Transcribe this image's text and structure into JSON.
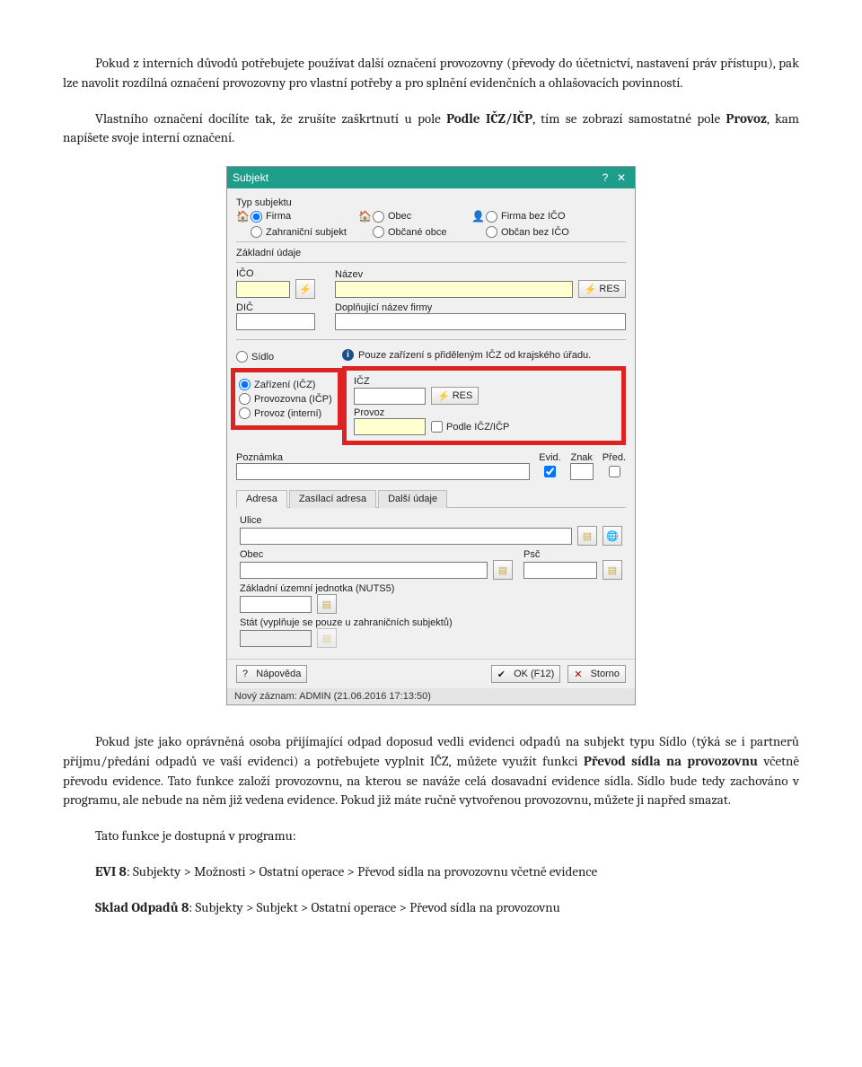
{
  "para1_prefix": "Pokud z",
  "para1_mid": "interních důvodů potřebujete používat další označení provozovny (převody do účetnictví, nastavení práv přístupu), pak lze navolit rozdílná označení provozovny pro vlastní potřeby a pro splnění evidenčních a ohlašovacích povinností.",
  "para2_prefix": "Vlastního označení docílíte tak, že zrušíte zaškrtnutí u pole ",
  "para2_bold1": "Podle IČZ/IČP",
  "para2_mid": ", tím se zobrazí samostatné pole ",
  "para2_bold2": "Provoz",
  "para2_suffix": ", kam napíšete svoje interní označení.",
  "dialog": {
    "title": "Subjekt",
    "typ_label": "Typ subjektu",
    "typ": {
      "firma": "Firma",
      "zahranicni": "Zahraniční subjekt",
      "obec": "Obec",
      "obcane": "Občané obce",
      "firma_bez": "Firma bez IČO",
      "obcan_bez": "Občan bez IČO"
    },
    "zakladni": "Základní údaje",
    "ico": "IČO",
    "nazev": "Název",
    "res": "RES",
    "dic": "DIČ",
    "dopl": "Doplňující název firmy",
    "info_text": "Pouze zařízení s přiděleným IČZ od krajského úřadu.",
    "sidlo": "Sídlo",
    "zarizeni": "Zařízení (IČZ)",
    "provozovna": "Provozovna (IČP)",
    "provoz_int": "Provoz (interní)",
    "icz": "IČZ",
    "provoz": "Provoz",
    "podle": "Podle IČZ/IČP",
    "poznamka": "Poznámka",
    "evid": "Evid.",
    "znak": "Znak",
    "pred": "Před.",
    "tabs": {
      "adresa": "Adresa",
      "zasilaci": "Zasílací adresa",
      "dalsi": "Další údaje"
    },
    "ulice": "Ulice",
    "obec_lbl": "Obec",
    "psc": "Psč",
    "nuts": "Základní územní jednotka (NUTS5)",
    "stat": "Stát (vyplňuje se pouze u zahraničních subjektů)",
    "napoveda": "Nápověda",
    "ok": "OK (F12)",
    "storno": "Storno",
    "status": "Nový záznam: ADMIN (21.06.2016 17:13:50)"
  },
  "para3": "Pokud jste jako oprávněná osoba přijímající odpad doposud vedli evidenci odpadů na subjekt typu Sídlo (týká se i partnerů příjmu/předání odpadů ve vaší evidenci) a potřebujete vyplnit IČZ, můžete využít funkci ",
  "para3_bold": "Převod sídla na provozovnu",
  "para3_suffix": " včetně převodu evidence. Tato funkce založí provozovnu, na kterou se naváže celá dosavadní evidence sídla. Sídlo bude tedy zachováno v programu, ale nebude na něm již vedena evidence. Pokud již máte ručně vytvořenou provozovnu, můžete ji napřed smazat.",
  "para4": "Tato funkce je dostupná v programu:",
  "evi8_lbl": "EVI 8",
  "evi8_path": ": Subjekty > Možnosti > Ostatní operace > Převod sídla na provozovnu včetně evidence",
  "sklad_lbl": "Sklad Odpadů 8",
  "sklad_path": ": Subjekty >  Subjekt > Ostatní operace > Převod sídla na provozovnu"
}
